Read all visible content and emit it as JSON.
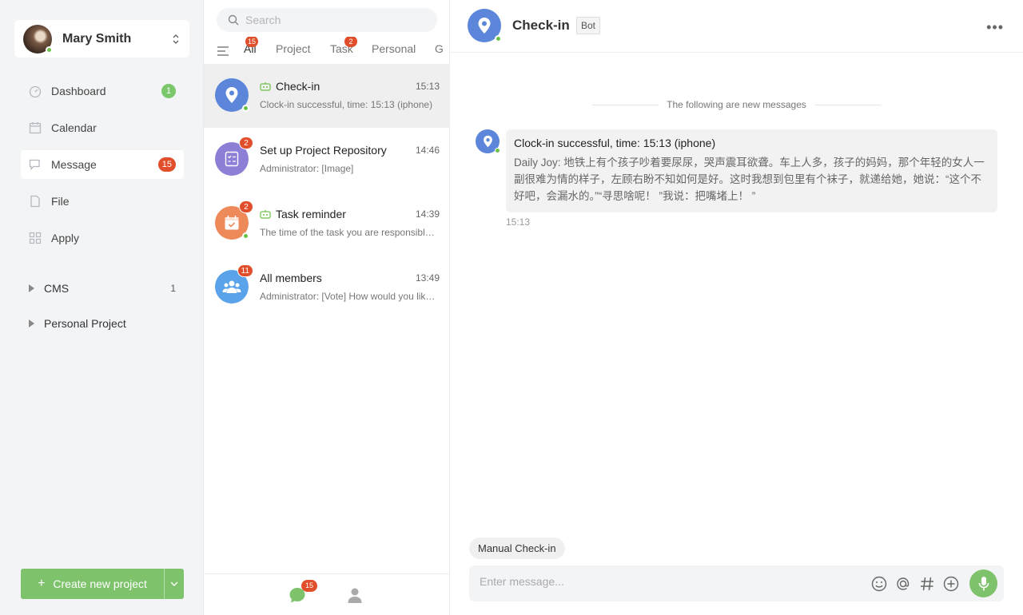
{
  "user": {
    "name": "Mary Smith",
    "status_color": "#6cc04a"
  },
  "nav": [
    {
      "label": "Dashboard",
      "icon": "dashboard-icon",
      "badge": "1",
      "badge_color": "#7bc86c"
    },
    {
      "label": "Calendar",
      "icon": "calendar-icon",
      "badge": null
    },
    {
      "label": "Message",
      "icon": "message-icon",
      "badge": "15",
      "badge_color": "#e04e2b",
      "active": true
    },
    {
      "label": "File",
      "icon": "file-icon",
      "badge": null
    },
    {
      "label": "Apply",
      "icon": "apps-icon",
      "badge": null
    }
  ],
  "groups": [
    {
      "label": "CMS",
      "count": "1"
    },
    {
      "label": "Personal Project",
      "count": ""
    }
  ],
  "create_button": {
    "label": "Create new project",
    "color": "#7ec36c"
  },
  "search": {
    "placeholder": "Search"
  },
  "tabs": [
    {
      "label": "All",
      "badge": "15",
      "active": true
    },
    {
      "label": "Project",
      "badge": null
    },
    {
      "label": "Task",
      "badge": "2"
    },
    {
      "label": "Personal",
      "badge": null
    },
    {
      "label": "G",
      "badge": null
    }
  ],
  "conversations": [
    {
      "title": "Check-in",
      "time": "15:13",
      "preview": "Clock-in successful, time: 15:13 (iphone)",
      "bot": true,
      "badge": null,
      "online": true,
      "avatar_color": "#5b86d9",
      "icon": "location-pin-icon"
    },
    {
      "title": "Set up Project Repository",
      "time": "14:46",
      "preview": "Administrator: [Image]",
      "bot": false,
      "badge": "2",
      "online": false,
      "avatar_color": "#8e7fd6",
      "icon": "checklist-icon"
    },
    {
      "title": "Task reminder",
      "time": "14:39",
      "preview": "The time of the task you are responsible for is approaching",
      "bot": true,
      "badge": "2",
      "online": true,
      "avatar_color": "#ee8a5a",
      "icon": "calendar-check-icon"
    },
    {
      "title": "All members",
      "time": "13:49",
      "preview": "Administrator: [Vote] How would you like to spend the weekend",
      "bot": false,
      "badge": "11",
      "online": false,
      "avatar_color": "#5aa3ea",
      "icon": "group-icon"
    }
  ],
  "footer": {
    "chat_badge": "15"
  },
  "chat": {
    "title": "Check-in",
    "tag": "Bot",
    "divider": "The following are new messages",
    "message": {
      "title": "Clock-in successful, time: 15:13 (iphone)",
      "body": "Daily Joy: 地铁上有个孩子吵着要尿尿，哭声震耳欲聋。车上人多，孩子的妈妈，那个年轻的女人一副很难为情的样子，左顾右盼不知如何是好。这时我想到包里有个袜子，就递给她，她说：“这个不好吧，会漏水的。”“寻思啥呢！ ”我说：把嘴堵上！ ”",
      "time": "15:13"
    },
    "quick_reply": "Manual Check-in",
    "input_placeholder": "Enter message..."
  }
}
